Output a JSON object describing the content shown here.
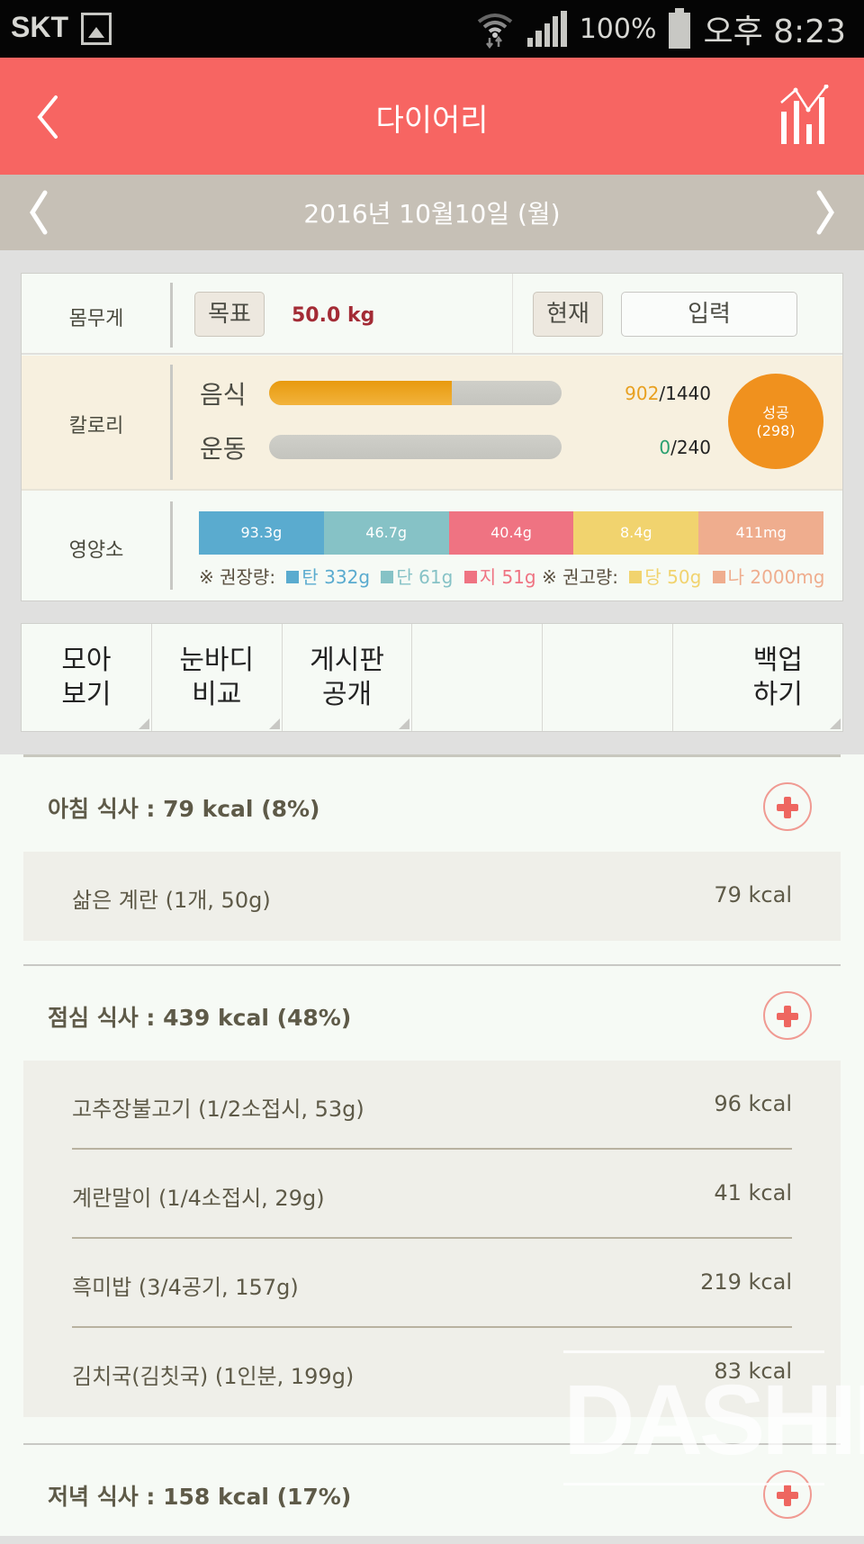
{
  "status_bar": {
    "carrier": "SKT",
    "battery_percent": "100%",
    "time": "오후 8:23"
  },
  "header": {
    "title": "다이어리",
    "back_icon": "chevron-left-icon",
    "stats_icon": "bar-line-chart-icon"
  },
  "date_nav": {
    "date": "2016년 10월10일 (월)",
    "prev_icon": "chevron-left-icon",
    "next_icon": "chevron-right-icon"
  },
  "summary": {
    "weight": {
      "label": "몸무게",
      "goal_label": "목표",
      "goal_value": "50.0 kg",
      "current_label": "현재",
      "input_label": "입력"
    },
    "calorie": {
      "label": "칼로리",
      "food_label": "음식",
      "food_value": "902",
      "food_target": "/1440",
      "food_progress": 0.626,
      "exercise_label": "운동",
      "exercise_value": "0",
      "exercise_target": "/240",
      "exercise_progress": 0,
      "status_label": "성공",
      "status_value": "(298)"
    },
    "nutrition": {
      "label": "영양소",
      "segments": [
        {
          "value": "93.3g",
          "color": "#5aabcf"
        },
        {
          "value": "46.7g",
          "color": "#86c2c6"
        },
        {
          "value": "40.4g",
          "color": "#ef7382"
        },
        {
          "value": "8.4g",
          "color": "#f1d36e"
        },
        {
          "value": "411mg",
          "color": "#efad8e"
        }
      ],
      "recommended_label": "※ 권장량:",
      "limit_label": "※ 권고량:",
      "legend": [
        {
          "text": "탄 332g",
          "color": "#5aabcf"
        },
        {
          "text": "단 61g",
          "color": "#86c2c6"
        },
        {
          "text": "지 51g",
          "color": "#ef7382"
        },
        {
          "text": "당 50g",
          "color": "#f1d36e"
        },
        {
          "text": "나 2000mg",
          "color": "#efad8e"
        }
      ]
    }
  },
  "menu": [
    {
      "label": "모아\n보기"
    },
    {
      "label": "눈바디\n비교"
    },
    {
      "label": "게시판\n공개"
    },
    {
      "label": ""
    },
    {
      "label": ""
    },
    {
      "label": "백업\n하기"
    }
  ],
  "meals": [
    {
      "title": "아침 식사 : 79 kcal (8%)",
      "items": [
        {
          "name": "삶은 계란 (1개, 50g)",
          "kcal": "79 kcal"
        }
      ]
    },
    {
      "title": "점심 식사 : 439 kcal (48%)",
      "items": [
        {
          "name": "고추장불고기 (1/2소접시, 53g)",
          "kcal": "96 kcal"
        },
        {
          "name": "계란말이 (1/4소접시, 29g)",
          "kcal": "41 kcal"
        },
        {
          "name": "흑미밥 (3/4공기, 157g)",
          "kcal": "219 kcal"
        },
        {
          "name": "김치국(김칫국) (1인분, 199g)",
          "kcal": "83 kcal"
        }
      ]
    },
    {
      "title": "저녁 식사 : 158 kcal (17%)",
      "items": []
    }
  ],
  "watermark": "DASHIN",
  "colors": {
    "header": "#f76562",
    "date_bar": "#c6c0b6",
    "accent_orange": "#f0911e",
    "goal_red": "#a32b35"
  }
}
